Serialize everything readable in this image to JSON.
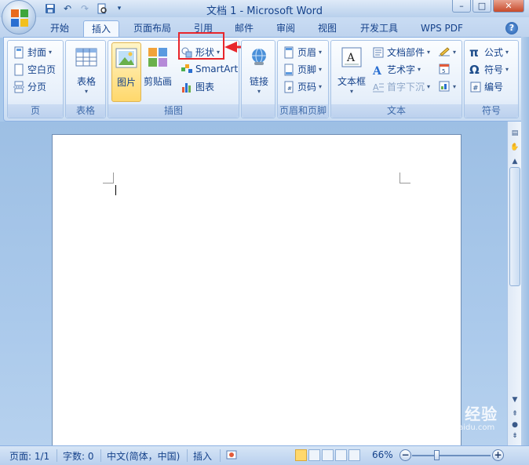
{
  "title": "文档 1 - Microsoft Word",
  "tabs": [
    "开始",
    "插入",
    "页面布局",
    "引用",
    "邮件",
    "审阅",
    "视图",
    "开发工具",
    "WPS PDF"
  ],
  "active_tab": "插入",
  "groups": {
    "pages": {
      "label": "页",
      "cover": "封面",
      "blank": "空白页",
      "break": "分页"
    },
    "tables": {
      "label": "表格",
      "table": "表格"
    },
    "illustrations": {
      "label": "插图",
      "picture": "图片",
      "clipart": "剪贴画",
      "shapes": "形状",
      "smartart": "SmartArt",
      "chart": "图表"
    },
    "links": {
      "label": "",
      "link": "链接"
    },
    "header_footer": {
      "label": "页眉和页脚",
      "header": "页眉",
      "footer": "页脚",
      "page_number": "页码"
    },
    "text": {
      "label": "文本",
      "textbox": "文本框",
      "quickparts": "文档部件",
      "wordart": "艺术字",
      "dropcap": "首字下沉"
    },
    "symbols": {
      "label": "符号",
      "equation": "公式",
      "symbol": "符号",
      "numbering": "编号"
    }
  },
  "status": {
    "page": "页面: 1/1",
    "words": "字数: 0",
    "language": "中文(简体，中国)",
    "mode": "插入",
    "zoom": "66%"
  },
  "watermark": {
    "brand": "Baidu 经验",
    "url": "jingyan.baidu.com"
  },
  "colors": {
    "highlight": "#e8262c",
    "ribbon_text": "#15428b"
  }
}
